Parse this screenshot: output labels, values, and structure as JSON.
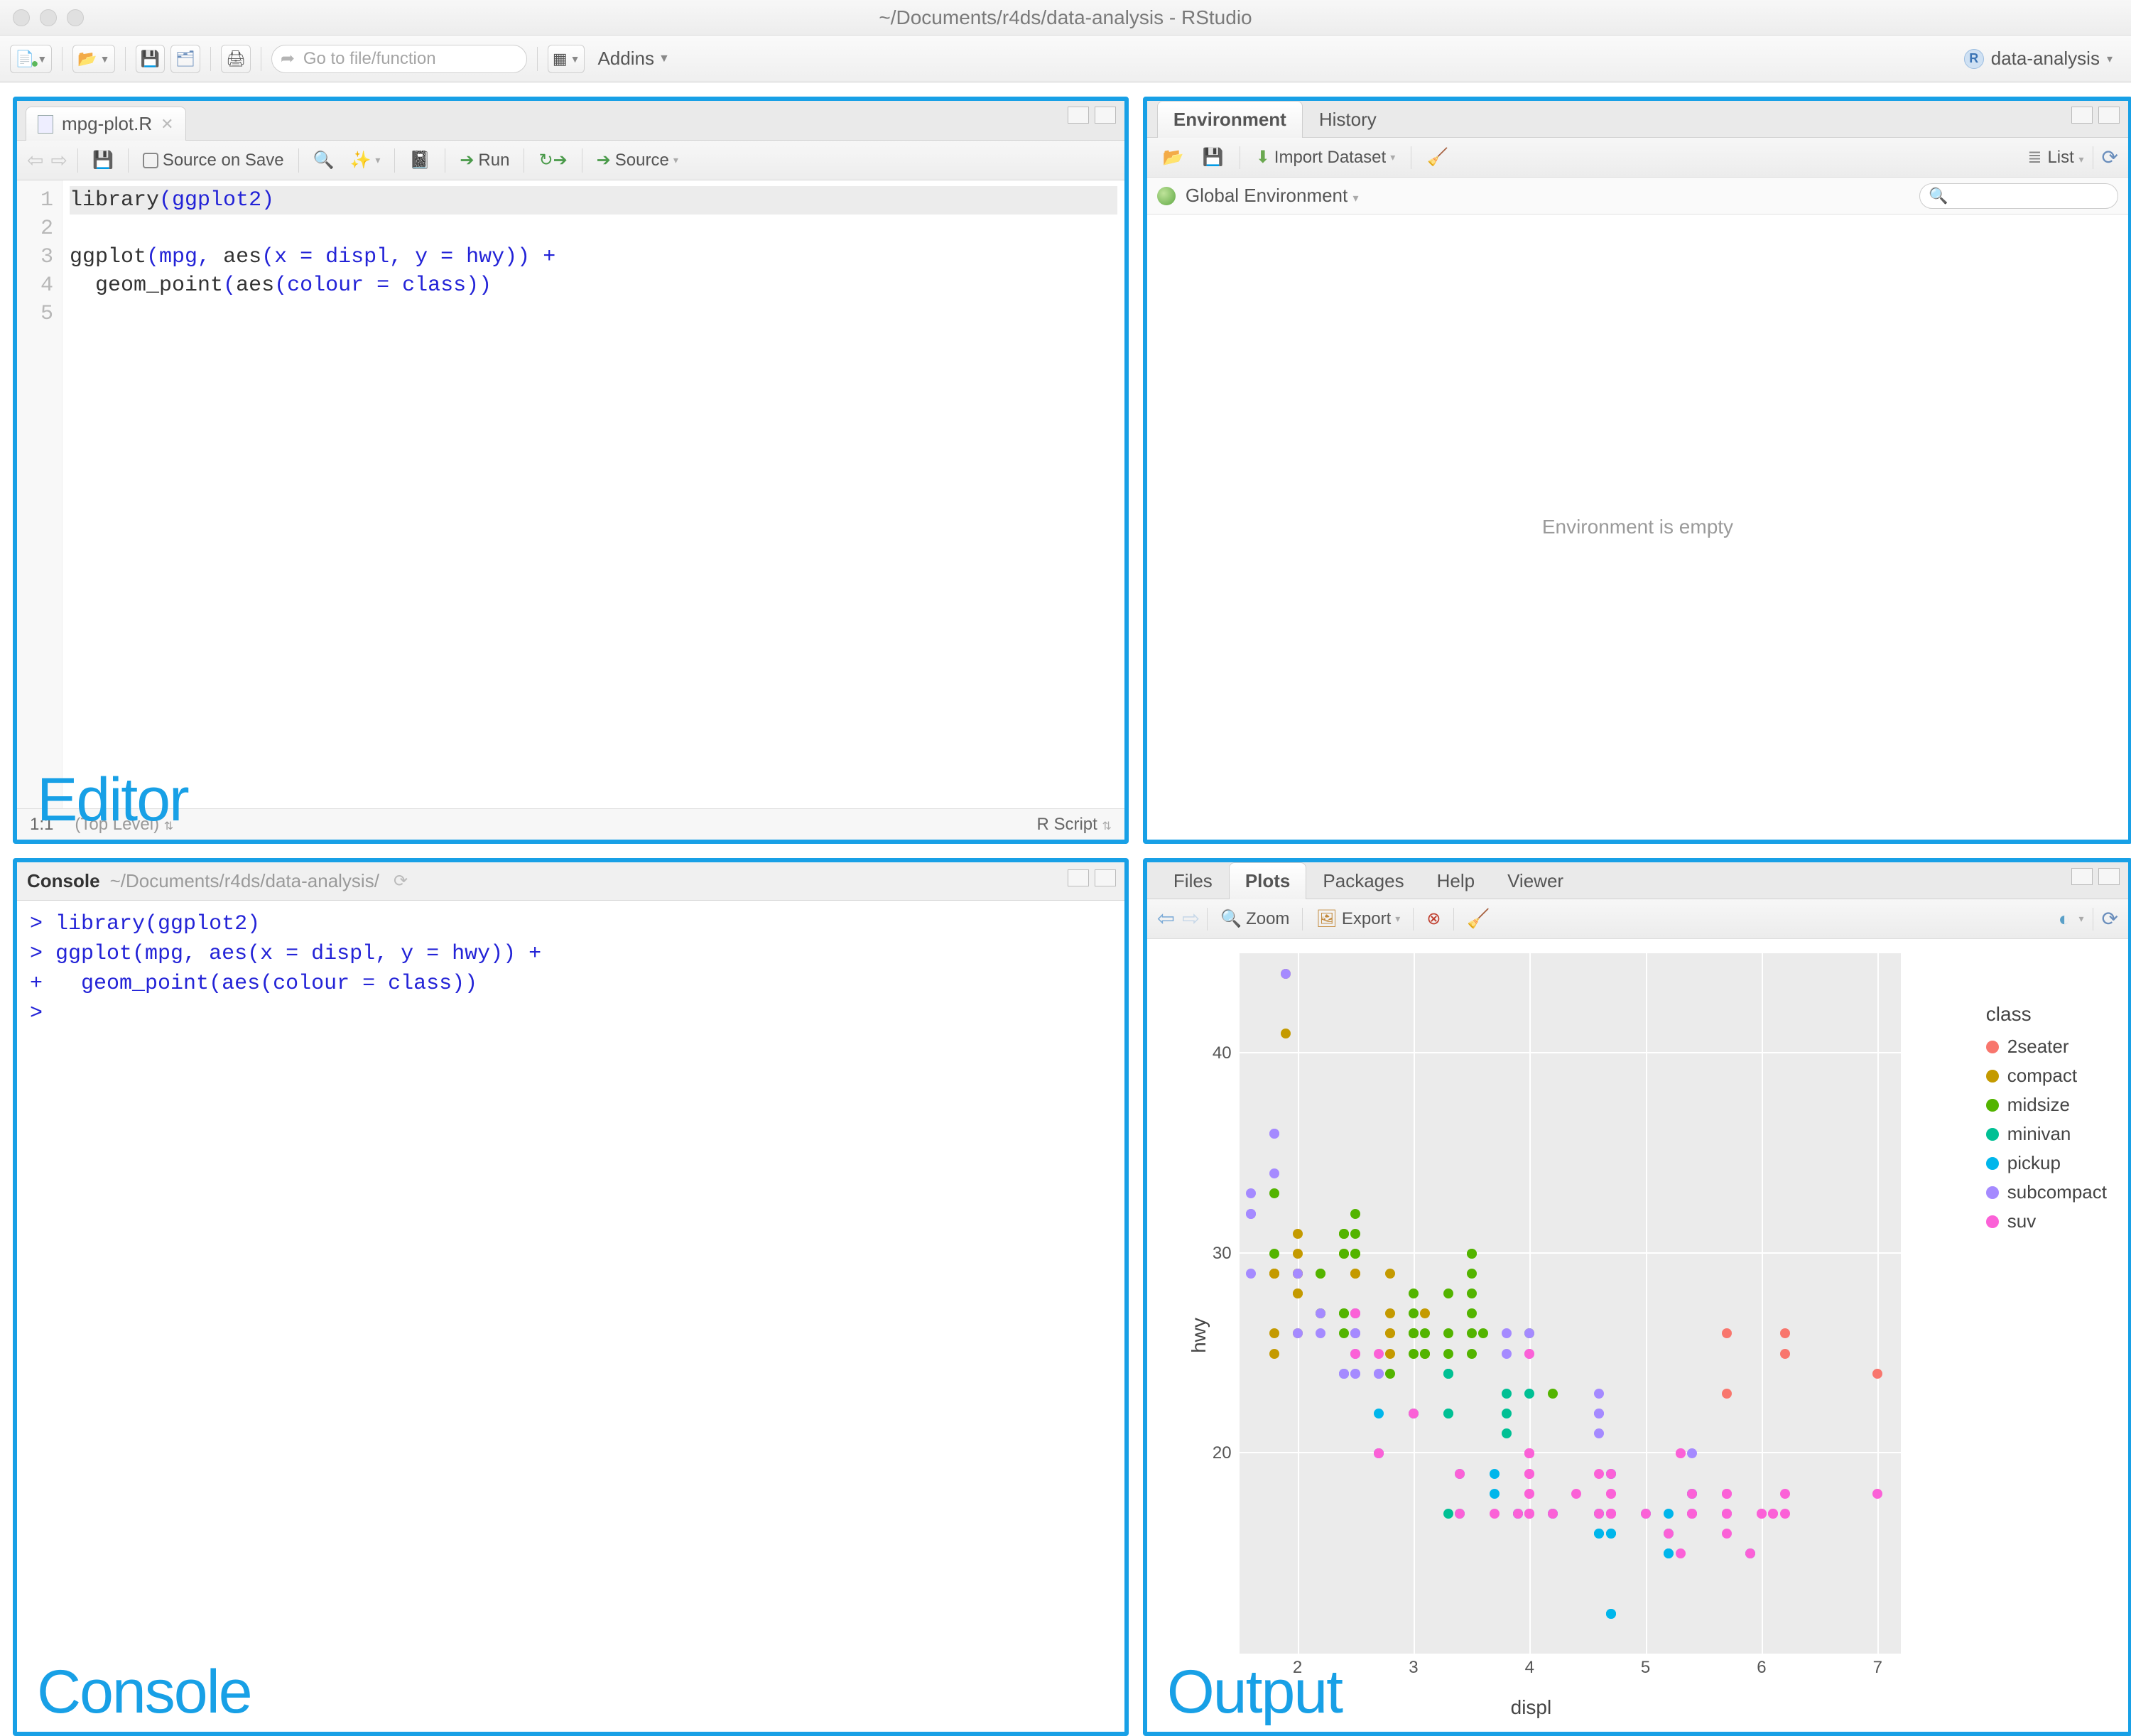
{
  "window": {
    "title": "~/Documents/r4ds/data-analysis - RStudio"
  },
  "main_toolbar": {
    "goto_placeholder": "Go to file/function",
    "addins_label": "Addins",
    "project_name": "data-analysis"
  },
  "editor": {
    "tab_name": "mpg-plot.R",
    "save_on_save_label": "Source on Save",
    "run_label": "Run",
    "source_label": "Source",
    "status_pos": "1:1",
    "status_scope": "(Top Level)",
    "status_type": "R Script",
    "code_lines": [
      "library(ggplot2)",
      "",
      "ggplot(mpg, aes(x = displ, y = hwy)) +",
      "  geom_point(aes(colour = class))",
      ""
    ],
    "pane_label": "Editor"
  },
  "console": {
    "tab_label": "Console",
    "path": "~/Documents/r4ds/data-analysis/",
    "lines": [
      {
        "prompt": ">",
        "text": "library(ggplot2)"
      },
      {
        "prompt": ">",
        "text": "ggplot(mpg, aes(x = displ, y = hwy)) +"
      },
      {
        "prompt": "+",
        "text": "  geom_point(aes(colour = class))"
      },
      {
        "prompt": ">",
        "text": ""
      }
    ],
    "pane_label": "Console"
  },
  "environment": {
    "tabs": [
      "Environment",
      "History"
    ],
    "import_label": "Import Dataset",
    "list_label": "List",
    "scope_label": "Global Environment",
    "empty_text": "Environment is empty"
  },
  "output": {
    "tabs": [
      "Files",
      "Plots",
      "Packages",
      "Help",
      "Viewer"
    ],
    "active_tab": "Plots",
    "zoom_label": "Zoom",
    "export_label": "Export",
    "pane_label": "Output"
  },
  "chart_data": {
    "type": "scatter",
    "xlabel": "displ",
    "ylabel": "hwy",
    "xlim": [
      1.5,
      7.2
    ],
    "ylim": [
      10,
      45
    ],
    "xticks": [
      2,
      3,
      4,
      5,
      6,
      7
    ],
    "yticks": [
      20,
      30,
      40
    ],
    "legend_title": "class",
    "legend": [
      {
        "name": "2seater",
        "color": "#f8766d"
      },
      {
        "name": "compact",
        "color": "#c49a00"
      },
      {
        "name": "midsize",
        "color": "#53b400"
      },
      {
        "name": "minivan",
        "color": "#00c094"
      },
      {
        "name": "pickup",
        "color": "#00b6eb"
      },
      {
        "name": "subcompact",
        "color": "#a58aff"
      },
      {
        "name": "suv",
        "color": "#fb61d7"
      }
    ],
    "series": [
      {
        "class": "2seater",
        "points": [
          [
            5.7,
            26
          ],
          [
            5.7,
            23
          ],
          [
            6.2,
            26
          ],
          [
            6.2,
            25
          ],
          [
            7.0,
            24
          ]
        ]
      },
      {
        "class": "compact",
        "points": [
          [
            1.8,
            29
          ],
          [
            1.8,
            29
          ],
          [
            2.0,
            31
          ],
          [
            2.0,
            30
          ],
          [
            2.8,
            26
          ],
          [
            2.8,
            26
          ],
          [
            3.1,
            27
          ],
          [
            1.8,
            26
          ],
          [
            1.8,
            25
          ],
          [
            2.0,
            28
          ],
          [
            2.0,
            29
          ],
          [
            2.8,
            27
          ],
          [
            2.8,
            25
          ],
          [
            3.1,
            25
          ],
          [
            3.1,
            25
          ],
          [
            2.4,
            30
          ],
          [
            2.4,
            30
          ],
          [
            2.5,
            26
          ],
          [
            2.5,
            27
          ],
          [
            2.2,
            27
          ],
          [
            2.2,
            29
          ],
          [
            2.4,
            31
          ],
          [
            2.4,
            31
          ],
          [
            3.0,
            26
          ],
          [
            2.0,
            26
          ],
          [
            2.0,
            29
          ],
          [
            1.9,
            44
          ],
          [
            2.0,
            29
          ],
          [
            2.0,
            29
          ],
          [
            2.5,
            29
          ],
          [
            2.5,
            29
          ],
          [
            2.8,
            29
          ],
          [
            1.9,
            41
          ],
          [
            1.8,
            29
          ],
          [
            1.8,
            29
          ],
          [
            2.0,
            28
          ],
          [
            2.0,
            29
          ]
        ]
      },
      {
        "class": "midsize",
        "points": [
          [
            2.8,
            24
          ],
          [
            3.1,
            25
          ],
          [
            4.2,
            23
          ],
          [
            2.4,
            27
          ],
          [
            2.4,
            30
          ],
          [
            3.1,
            26
          ],
          [
            3.5,
            29
          ],
          [
            3.6,
            26
          ],
          [
            2.4,
            26
          ],
          [
            2.4,
            27
          ],
          [
            2.5,
            30
          ],
          [
            2.5,
            30
          ],
          [
            3.3,
            28
          ],
          [
            2.5,
            31
          ],
          [
            2.5,
            32
          ],
          [
            3.0,
            27
          ],
          [
            3.3,
            26
          ],
          [
            3.5,
            28
          ],
          [
            3.0,
            26
          ],
          [
            3.0,
            25
          ],
          [
            3.5,
            26
          ],
          [
            3.5,
            25
          ],
          [
            3.0,
            26
          ],
          [
            3.0,
            28
          ],
          [
            3.3,
            25
          ],
          [
            3.3,
            24
          ],
          [
            4.0,
            26
          ],
          [
            2.2,
            27
          ],
          [
            2.2,
            29
          ],
          [
            2.4,
            31
          ],
          [
            2.4,
            31
          ],
          [
            3.0,
            26
          ],
          [
            3.5,
            30
          ],
          [
            3.5,
            30
          ],
          [
            3.5,
            27
          ],
          [
            1.8,
            30
          ],
          [
            1.8,
            33
          ]
        ]
      },
      {
        "class": "minivan",
        "points": [
          [
            2.4,
            24
          ],
          [
            3.0,
            22
          ],
          [
            3.3,
            22
          ],
          [
            3.3,
            22
          ],
          [
            3.3,
            24
          ],
          [
            3.3,
            24
          ],
          [
            3.3,
            17
          ],
          [
            3.8,
            22
          ],
          [
            3.8,
            21
          ],
          [
            3.8,
            23
          ],
          [
            4.0,
            23
          ]
        ]
      },
      {
        "class": "pickup",
        "points": [
          [
            3.7,
            19
          ],
          [
            3.7,
            18
          ],
          [
            3.9,
            17
          ],
          [
            3.9,
            17
          ],
          [
            4.7,
            19
          ],
          [
            4.7,
            19
          ],
          [
            4.7,
            12
          ],
          [
            5.2,
            17
          ],
          [
            5.2,
            15
          ],
          [
            4.7,
            16
          ],
          [
            4.7,
            12
          ],
          [
            4.7,
            17
          ],
          [
            4.7,
            17
          ],
          [
            4.7,
            16
          ],
          [
            4.7,
            12
          ],
          [
            5.2,
            15
          ],
          [
            5.2,
            16
          ],
          [
            5.7,
            17
          ],
          [
            5.9,
            15
          ],
          [
            2.7,
            20
          ],
          [
            2.7,
            20
          ],
          [
            2.7,
            22
          ],
          [
            3.4,
            17
          ],
          [
            3.4,
            19
          ],
          [
            4.0,
            20
          ],
          [
            4.0,
            17
          ],
          [
            4.6,
            17
          ],
          [
            5.0,
            17
          ],
          [
            4.2,
            17
          ],
          [
            4.2,
            17
          ],
          [
            4.6,
            16
          ],
          [
            4.6,
            16
          ],
          [
            4.6,
            17
          ],
          [
            5.4,
            17
          ],
          [
            5.4,
            18
          ],
          [
            5.4,
            18
          ]
        ]
      },
      {
        "class": "subcompact",
        "points": [
          [
            3.8,
            26
          ],
          [
            3.8,
            25
          ],
          [
            4.0,
            26
          ],
          [
            4.0,
            25
          ],
          [
            4.6,
            21
          ],
          [
            4.6,
            22
          ],
          [
            4.6,
            23
          ],
          [
            4.6,
            22
          ],
          [
            5.4,
            20
          ],
          [
            1.6,
            33
          ],
          [
            1.6,
            32
          ],
          [
            1.6,
            32
          ],
          [
            1.6,
            29
          ],
          [
            1.6,
            32
          ],
          [
            1.8,
            34
          ],
          [
            1.8,
            36
          ],
          [
            1.8,
            36
          ],
          [
            2.0,
            29
          ],
          [
            2.4,
            24
          ],
          [
            2.4,
            24
          ],
          [
            2.5,
            24
          ],
          [
            2.5,
            24
          ],
          [
            2.5,
            26
          ],
          [
            2.5,
            26
          ],
          [
            2.2,
            26
          ],
          [
            2.2,
            27
          ],
          [
            2.5,
            25
          ],
          [
            2.5,
            27
          ],
          [
            2.5,
            25
          ],
          [
            2.5,
            27
          ],
          [
            2.7,
            24
          ],
          [
            2.7,
            24
          ],
          [
            2.7,
            24
          ],
          [
            1.9,
            44
          ],
          [
            2.0,
            26
          ]
        ]
      },
      {
        "class": "suv",
        "points": [
          [
            5.3,
            20
          ],
          [
            5.3,
            15
          ],
          [
            5.3,
            20
          ],
          [
            5.7,
            17
          ],
          [
            6.0,
            17
          ],
          [
            5.7,
            18
          ],
          [
            5.7,
            17
          ],
          [
            6.2,
            18
          ],
          [
            6.2,
            17
          ],
          [
            7.0,
            18
          ],
          [
            6.1,
            17
          ],
          [
            3.9,
            17
          ],
          [
            4.7,
            17
          ],
          [
            4.7,
            18
          ],
          [
            4.7,
            17
          ],
          [
            5.2,
            16
          ],
          [
            5.7,
            16
          ],
          [
            5.9,
            15
          ],
          [
            4.0,
            19
          ],
          [
            4.0,
            19
          ],
          [
            4.0,
            17
          ],
          [
            4.0,
            17
          ],
          [
            4.6,
            19
          ],
          [
            5.0,
            17
          ],
          [
            3.0,
            22
          ],
          [
            3.7,
            17
          ],
          [
            4.0,
            17
          ],
          [
            4.7,
            17
          ],
          [
            4.7,
            17
          ],
          [
            4.7,
            18
          ],
          [
            5.7,
            18
          ],
          [
            6.1,
            17
          ],
          [
            4.0,
            17
          ],
          [
            4.2,
            17
          ],
          [
            4.4,
            18
          ],
          [
            4.6,
            17
          ],
          [
            5.4,
            17
          ],
          [
            5.4,
            17
          ],
          [
            5.4,
            18
          ],
          [
            4.0,
            20
          ],
          [
            4.0,
            20
          ],
          [
            4.0,
            18
          ],
          [
            4.0,
            18
          ],
          [
            4.0,
            25
          ],
          [
            2.5,
            25
          ],
          [
            2.5,
            27
          ],
          [
            2.7,
            25
          ],
          [
            4.0,
            20
          ],
          [
            4.0,
            19
          ],
          [
            4.0,
            20
          ],
          [
            4.7,
            19
          ],
          [
            4.7,
            17
          ],
          [
            5.7,
            18
          ],
          [
            2.7,
            20
          ],
          [
            2.7,
            20
          ],
          [
            3.4,
            17
          ],
          [
            3.4,
            19
          ],
          [
            4.0,
            20
          ],
          [
            4.7,
            17
          ],
          [
            5.7,
            17
          ],
          [
            6.0,
            17
          ]
        ]
      }
    ]
  }
}
